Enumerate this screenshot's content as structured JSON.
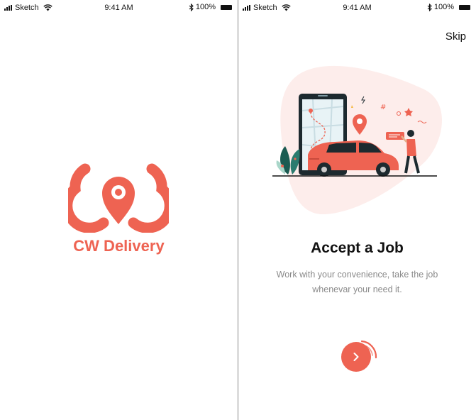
{
  "status_bar": {
    "carrier": "Sketch",
    "time": "9:41 AM",
    "battery": "100%",
    "icons": [
      "signal-icon",
      "wifi-icon",
      "bluetooth-icon",
      "battery-icon"
    ]
  },
  "splash": {
    "brand_name": "CW Delivery",
    "logo_icon": "cw-pin-logo-icon"
  },
  "onboarding": {
    "skip_label": "Skip",
    "title": "Accept a Job",
    "description_line1": "Work with your convenience, take the job",
    "description_line2": "whenevar your need it.",
    "next_icon": "chevron-right-icon",
    "illustration": "car-phone-map-illustration"
  },
  "colors": {
    "accent": "#EE6352",
    "text_primary": "#111111",
    "text_secondary": "#8a8a8a",
    "blob": "#FDEDEB"
  }
}
